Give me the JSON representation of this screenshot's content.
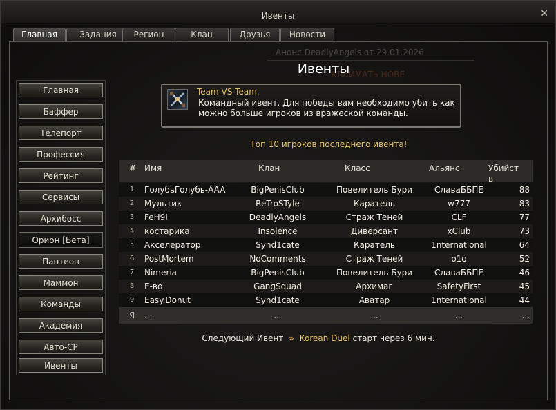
{
  "window": {
    "title": "Ивенты",
    "close_symbol": "✕"
  },
  "tabs": [
    {
      "label": "Главная",
      "active": true
    },
    {
      "label": "Задания",
      "active": false
    },
    {
      "label": "Регион",
      "active": false
    },
    {
      "label": "Клан",
      "active": false
    },
    {
      "label": "Друзья",
      "active": false
    },
    {
      "label": "Новости",
      "active": false
    }
  ],
  "sidebar": {
    "items": [
      {
        "label": "Главная",
        "active": false
      },
      {
        "label": "Баффер",
        "active": false
      },
      {
        "label": "Телепорт",
        "active": false
      },
      {
        "label": "Профессия",
        "active": false
      },
      {
        "label": "Рейтинг",
        "active": false
      },
      {
        "label": "Сервисы",
        "active": false
      },
      {
        "label": "Архибосс",
        "active": false
      },
      {
        "label": "Орион [Бета]",
        "active": true
      },
      {
        "label": "Пантеон",
        "active": false
      },
      {
        "label": "Маммон",
        "active": false
      },
      {
        "label": "Команды",
        "active": false
      },
      {
        "label": "Академия",
        "active": false
      },
      {
        "label": "Авто-СР",
        "active": false
      },
      {
        "label": "Ивенты",
        "active": false
      }
    ]
  },
  "background_text": {
    "announce": "Анонс DeadlyAngels от 29.01.2026",
    "button": "КЛАЙМАТЬ НОВЕ"
  },
  "main": {
    "title": "Ивенты",
    "event": {
      "icon": "crossed-swords-icon",
      "name": "Team VS Team.",
      "description": "Командный ивент. Для победы вам необходимо убить как можно больше игроков из вражеской команды."
    },
    "top_caption": "Топ 10 игроков последнего ивента!",
    "table": {
      "headers": {
        "num": "#",
        "name": "Имя",
        "clan": "Клан",
        "class": "Класс",
        "ally": "Альянс",
        "kills": "Убийств"
      },
      "rows": [
        {
          "num": "1",
          "name": "ГолубьГолубь-AAA",
          "clan": "BigPenisClub",
          "class": "Повелитель Бури",
          "ally": "СлаваББПЕ",
          "kills": "88"
        },
        {
          "num": "2",
          "name": "Мультик",
          "clan": "ReTroSTyle",
          "class": "Каратель",
          "ally": "w777",
          "kills": "83"
        },
        {
          "num": "3",
          "name": "FeH9I",
          "clan": "DeadlyAngels",
          "class": "Страж Теней",
          "ally": "CLF",
          "kills": "77"
        },
        {
          "num": "4",
          "name": "костарика",
          "clan": "Insolence",
          "class": "Диверсант",
          "ally": "xClub",
          "kills": "73"
        },
        {
          "num": "5",
          "name": "Акселератор",
          "clan": "Synd1cate",
          "class": "Каратель",
          "ally": "1nternational",
          "kills": "64"
        },
        {
          "num": "6",
          "name": "PostMortem",
          "clan": "NoComments",
          "class": "Страж Теней",
          "ally": "o1o",
          "kills": "52"
        },
        {
          "num": "7",
          "name": "Nimeria",
          "clan": "BigPenisClub",
          "class": "Повелитель Бури",
          "ally": "СлаваББПЕ",
          "kills": "46"
        },
        {
          "num": "8",
          "name": "E-во",
          "clan": "GangSquad",
          "class": "Архимаг",
          "ally": "SafetyFirst",
          "kills": "45"
        },
        {
          "num": "9",
          "name": "Easy.Donut",
          "clan": "Synd1cate",
          "class": "Аватар",
          "ally": "1nternational",
          "kills": "44"
        },
        {
          "num": "Я",
          "name": "...",
          "clan": "...",
          "class": "...",
          "ally": "...",
          "kills": "..."
        }
      ]
    },
    "next_event": {
      "prefix": "Следующий Ивент",
      "arrows": "»",
      "name": "Korean Duel",
      "suffix": "старт через 6 мин."
    }
  }
}
